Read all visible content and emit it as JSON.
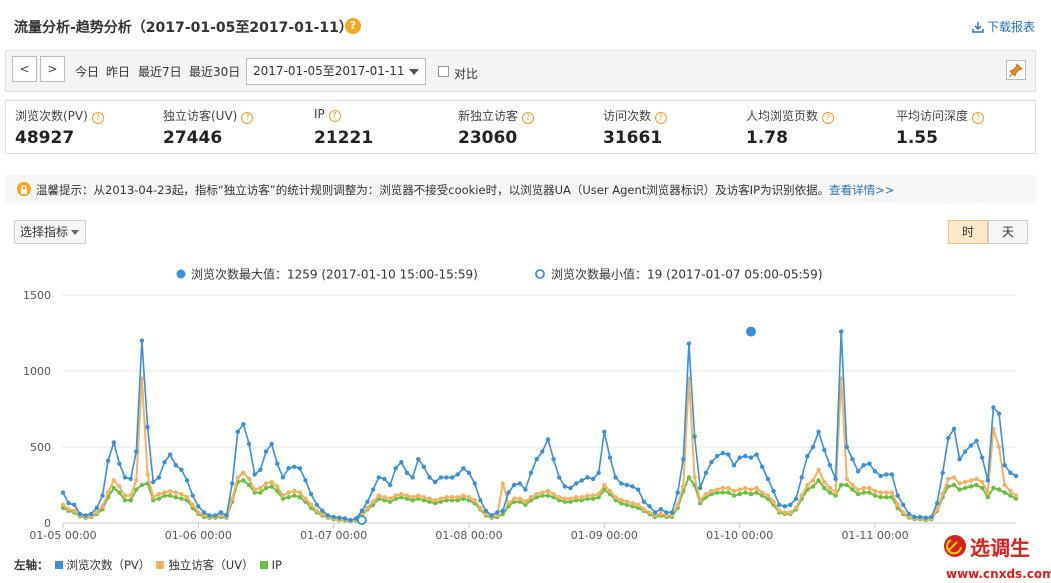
{
  "header": {
    "title": "流量分析-趋势分析（2017-01-05至2017-01-11）",
    "help": "?",
    "download_label": "下载报表"
  },
  "toolbar": {
    "prev": "<",
    "next": ">",
    "quick": [
      "今日",
      "昨日",
      "最近7日",
      "最近30日"
    ],
    "date_range": "2017-01-05至2017-01-11",
    "compare_label": "对比"
  },
  "metrics": [
    {
      "label": "浏览次数(PV)",
      "value": "48927"
    },
    {
      "label": "独立访客(UV)",
      "value": "27446"
    },
    {
      "label": "IP",
      "value": "21221"
    },
    {
      "label": "新独立访客",
      "value": "23060"
    },
    {
      "label": "访问次数",
      "value": "31661"
    },
    {
      "label": "人均浏览页数",
      "value": "1.78"
    },
    {
      "label": "平均访问深度",
      "value": "1.55"
    }
  ],
  "notice": {
    "text": "温馨提示：从2013-04-23起，指标“独立访客”的统计规则调整为：浏览器不接受cookie时，以浏览器UA（User Agent浏览器标识）及访客IP为识别依据。",
    "link": "查看详情>>"
  },
  "controls": {
    "select_metric": "选择指标",
    "hour": "时",
    "day": "天"
  },
  "chart_data": {
    "type": "line",
    "max_label": "浏览次数最大值：1259 (2017-01-10 15:00-15:59)",
    "min_label": "浏览次数最小值：19 (2017-01-07 05:00-05:59)",
    "y_ticks": [
      "1500",
      "1000",
      "500",
      "0"
    ],
    "ylim": [
      0,
      1500
    ],
    "x_ticks": [
      "01-05 00:00",
      "01-06 00:00",
      "01-07 00:00",
      "01-08 00:00",
      "01-09 00:00",
      "01-10 00:00",
      "01-11 00:00"
    ],
    "grid": true,
    "axis_legend_prefix": "左轴：",
    "colors": {
      "pv": "#3a8fd9",
      "uv": "#f0b264",
      "ip": "#6abf40",
      "grid": "#e6e6e6"
    },
    "max_point": {
      "series": 0,
      "index": 122,
      "value": 1259
    },
    "min_point": {
      "series": 0,
      "index": 53,
      "value": 19
    },
    "series": [
      {
        "name": "浏览次数（PV）",
        "values": [
          200,
          130,
          120,
          60,
          50,
          60,
          100,
          180,
          410,
          530,
          390,
          300,
          290,
          470,
          1200,
          630,
          270,
          300,
          400,
          450,
          380,
          350,
          280,
          180,
          110,
          70,
          50,
          50,
          70,
          50,
          260,
          600,
          650,
          520,
          320,
          350,
          470,
          520,
          390,
          300,
          360,
          370,
          360,
          280,
          190,
          120,
          80,
          50,
          40,
          35,
          30,
          19,
          30,
          80,
          140,
          220,
          300,
          290,
          250,
          360,
          400,
          330,
          300,
          420,
          370,
          300,
          270,
          300,
          300,
          300,
          320,
          360,
          330,
          260,
          150,
          80,
          50,
          70,
          80,
          200,
          250,
          260,
          220,
          330,
          420,
          470,
          550,
          420,
          300,
          240,
          230,
          260,
          280,
          300,
          290,
          330,
          600,
          430,
          300,
          260,
          250,
          240,
          220,
          140,
          110,
          70,
          90,
          70,
          70,
          200,
          420,
          1180,
          570,
          230,
          330,
          400,
          440,
          460,
          450,
          380,
          430,
          440,
          430,
          450,
          370,
          290,
          210,
          120,
          110,
          120,
          160,
          300,
          440,
          500,
          600,
          480,
          380,
          290,
          1259,
          500,
          420,
          340,
          380,
          390,
          340,
          310,
          320,
          320,
          180,
          120,
          60,
          40,
          40,
          35,
          40,
          130,
          330,
          560,
          620,
          420,
          470,
          510,
          540,
          430,
          280,
          760,
          720,
          380,
          330,
          310
        ]
      },
      {
        "name": "独立访客（UV）",
        "values": [
          120,
          90,
          80,
          50,
          40,
          45,
          70,
          110,
          200,
          280,
          240,
          180,
          180,
          280,
          950,
          320,
          170,
          190,
          200,
          210,
          200,
          190,
          170,
          120,
          70,
          50,
          40,
          40,
          50,
          40,
          160,
          300,
          330,
          290,
          220,
          230,
          260,
          270,
          240,
          180,
          200,
          210,
          200,
          160,
          120,
          80,
          60,
          40,
          30,
          25,
          22,
          15,
          22,
          60,
          100,
          140,
          180,
          170,
          160,
          180,
          190,
          180,
          170,
          180,
          170,
          160,
          150,
          160,
          170,
          170,
          170,
          180,
          170,
          150,
          100,
          60,
          40,
          50,
          260,
          130,
          160,
          160,
          140,
          170,
          190,
          200,
          210,
          190,
          170,
          160,
          160,
          170,
          170,
          180,
          180,
          190,
          250,
          210,
          170,
          150,
          140,
          130,
          120,
          90,
          70,
          50,
          60,
          50,
          50,
          120,
          240,
          950,
          300,
          150,
          190,
          210,
          220,
          230,
          230,
          210,
          220,
          230,
          220,
          230,
          200,
          180,
          140,
          80,
          70,
          70,
          100,
          180,
          250,
          280,
          350,
          270,
          230,
          200,
          950,
          290,
          250,
          220,
          230,
          230,
          210,
          200,
          200,
          200,
          120,
          70,
          40,
          30,
          30,
          25,
          30,
          90,
          190,
          290,
          300,
          260,
          270,
          280,
          290,
          270,
          200,
          620,
          500,
          250,
          210,
          180
        ]
      },
      {
        "name": "IP",
        "values": [
          100,
          80,
          70,
          45,
          35,
          40,
          60,
          90,
          170,
          230,
          200,
          150,
          150,
          220,
          250,
          260,
          150,
          160,
          180,
          180,
          170,
          160,
          150,
          100,
          60,
          40,
          35,
          35,
          40,
          35,
          140,
          270,
          280,
          250,
          200,
          200,
          230,
          240,
          210,
          160,
          170,
          180,
          170,
          140,
          100,
          70,
          50,
          35,
          25,
          20,
          18,
          12,
          18,
          50,
          90,
          120,
          160,
          150,
          140,
          160,
          170,
          160,
          150,
          160,
          150,
          140,
          130,
          140,
          150,
          150,
          150,
          160,
          150,
          130,
          90,
          50,
          35,
          40,
          60,
          110,
          140,
          140,
          120,
          150,
          170,
          180,
          180,
          170,
          150,
          140,
          140,
          150,
          150,
          160,
          160,
          170,
          220,
          190,
          150,
          130,
          120,
          110,
          100,
          80,
          60,
          40,
          50,
          40,
          40,
          100,
          210,
          300,
          250,
          130,
          170,
          190,
          200,
          200,
          200,
          180,
          190,
          200,
          190,
          200,
          180,
          160,
          120,
          70,
          60,
          60,
          90,
          160,
          220,
          240,
          280,
          230,
          200,
          180,
          250,
          250,
          220,
          190,
          200,
          200,
          180,
          170,
          170,
          170,
          100,
          60,
          35,
          25,
          25,
          20,
          25,
          80,
          170,
          240,
          250,
          220,
          230,
          240,
          250,
          230,
          170,
          230,
          220,
          200,
          180,
          160
        ]
      }
    ]
  }
}
